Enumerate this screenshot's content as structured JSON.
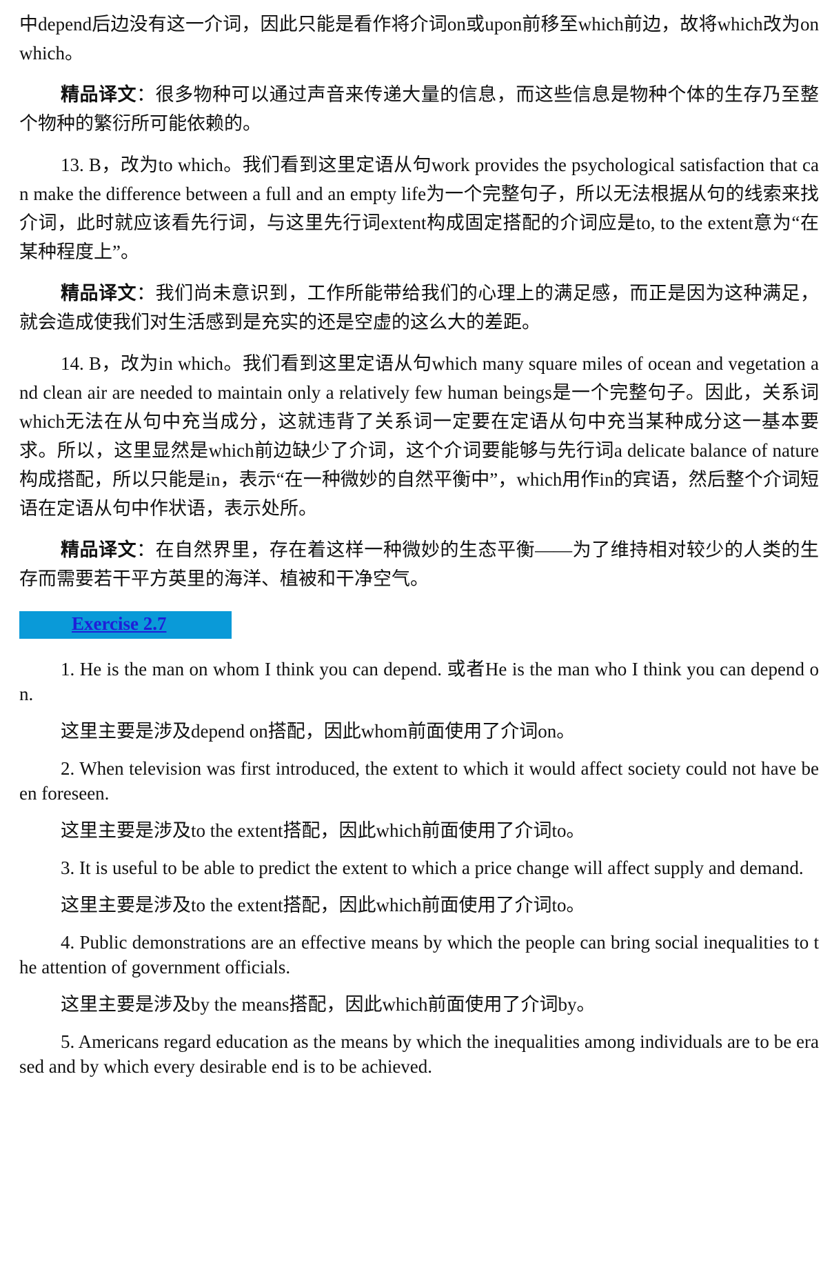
{
  "paragraphs_top": [
    {
      "label": "",
      "text": "中depend后边没有这一介词，因此只能是看作将介词on或upon前移至which前边，故将which改为on which。"
    },
    {
      "label": "精品译文",
      "text": "：很多物种可以通过声音来传递大量的信息，而这些信息是物种个体的生存乃至整个物种的繁衍所可能依赖的。"
    },
    {
      "label": "",
      "text": "13. B，改为to which。我们看到这里定语从句work provides the psychological satisfaction that can make the difference between a full and an empty life为一个完整句子，所以无法根据从句的线索来找介词，此时就应该看先行词，与这里先行词extent构成固定搭配的介词应是to, to the extent意为“在某种程度上”。"
    },
    {
      "label": "精品译文",
      "text": "：我们尚未意识到，工作所能带给我们的心理上的满足感，而正是因为这种满足，就会造成使我们对生活感到是充实的还是空虚的这么大的差距。"
    },
    {
      "label": "",
      "text": "14. B，改为in which。我们看到这里定语从句which many square miles of ocean and vegetation and clean air are needed to maintain only a relatively few human beings是一个完整句子。因此，关系词which无法在从句中充当成分，这就违背了关系词一定要在定语从句中充当某种成分这一基本要求。所以，这里显然是which前边缺少了介词，这个介词要能够与先行词a delicate balance of nature构成搭配，所以只能是in，表示“在一种微妙的自然平衡中”，which用作in的宾语，然后整个介词短语在定语从句中作状语，表示处所。"
    },
    {
      "label": "精品译文",
      "text": "：在自然界里，存在着这样一种微妙的生态平衡——为了维持相对较少的人类的生存而需要若干平方英里的海洋、植被和干净空气。"
    }
  ],
  "exercise": {
    "title": "Exercise 2.7"
  },
  "paragraphs_bottom": [
    {
      "text": "1. He is the man on whom I think you can depend. 或者He is the man who I think you can depend on."
    },
    {
      "text": "这里主要是涉及depend on搭配，因此whom前面使用了介词on。"
    },
    {
      "text": "2. When television was first introduced, the extent to which it would affect society could not have been foreseen."
    },
    {
      "text": "这里主要是涉及to the extent搭配，因此which前面使用了介词to。"
    },
    {
      "text": "3. It is useful to be able to predict the extent to which a price change will affect supply and demand."
    },
    {
      "text": "这里主要是涉及to the extent搭配，因此which前面使用了介词to。"
    },
    {
      "text": "4. Public demonstrations are an effective means by which the people can bring social inequalities to the attention of government officials."
    },
    {
      "text": "这里主要是涉及by the means搭配，因此which前面使用了介词by。"
    },
    {
      "text": "5. Americans regard education as the means by which the inequalities among individuals are to be erased and by which every desirable end is to be achieved."
    }
  ],
  "colors": {
    "banner_bg": "#0a9ad8",
    "link": "#1f1fd8"
  }
}
